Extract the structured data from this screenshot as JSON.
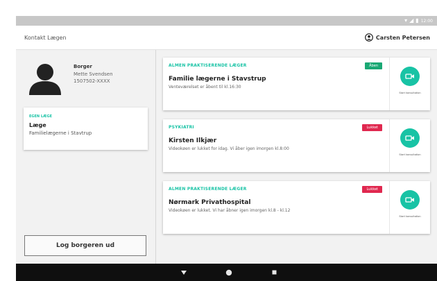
{
  "status_bar": {
    "time": "12:00",
    "icons": [
      "wifi-icon",
      "signal-icon",
      "battery-icon"
    ]
  },
  "header": {
    "title": "Kontakt Lægen",
    "user_name": "Carsten Petersen"
  },
  "sidebar": {
    "citizen_label": "Borger",
    "citizen_name": "Mette Svendsen",
    "citizen_cpr": "1507502-XXXX",
    "doctor_card": {
      "section": "EGEN LÆGE",
      "title": "Læge",
      "subtitle": "Familielægerne i Stavtrup"
    },
    "logout_label": "Log borgeren ud"
  },
  "cards": [
    {
      "category": "ALMEN PRAKTISERENDE LÆGER",
      "badge": "Åben",
      "badge_color": "#1aa874",
      "title": "Familie lægerne i Stavstrup",
      "subtitle": "Venteværelset er åbent til kl.16:30",
      "action_label": "Start konsultation"
    },
    {
      "category": "PSYKIATRI",
      "badge": "Lukket",
      "badge_color": "#e0284f",
      "title": "Kirsten Ilkjær",
      "subtitle": "Videokøen er lukket for idag. Vi åber igen imorgen kl.8:00",
      "action_label": "Start konsultation"
    },
    {
      "category": "ALMEN PRAKTISERENDE LÆGER",
      "badge": "Lukket",
      "badge_color": "#e0284f",
      "title": "Nørmark Privathospital",
      "subtitle": "Videokøen er lukket. Vi har åbner igen imorgen kl.8 - kl.12",
      "action_label": "Start konsultation"
    }
  ],
  "colors": {
    "accent": "#18c3a5",
    "open": "#1aa874",
    "closed": "#e0284f",
    "nav_bg": "#0f0f0f"
  },
  "navigation": {
    "icons": [
      "back-icon",
      "home-icon",
      "recents-icon"
    ]
  }
}
